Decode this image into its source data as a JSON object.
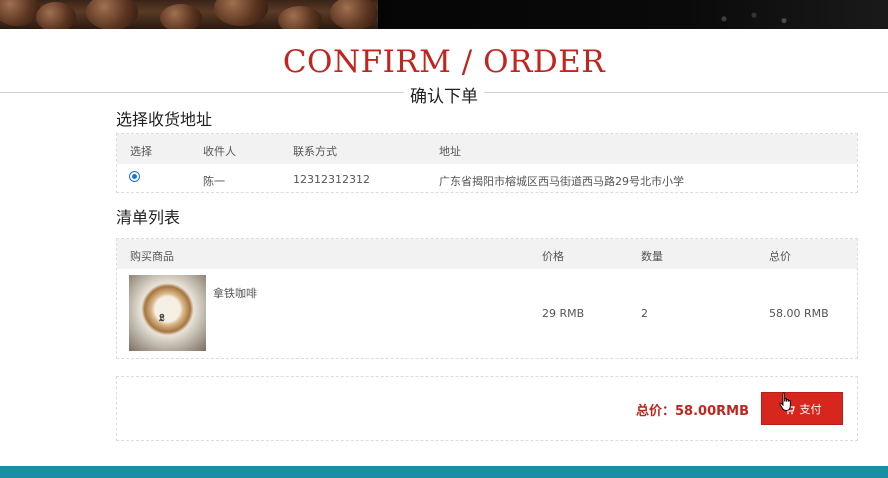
{
  "header": {
    "title_en": "CONFIRM / ORDER",
    "title_cn": "确认下单"
  },
  "address_section": {
    "title": "选择收货地址",
    "columns": [
      "选择",
      "收件人",
      "联系方式",
      "地址"
    ],
    "rows": [
      {
        "selected": true,
        "recipient": "陈一",
        "phone": "12312312312",
        "address": "广东省揭阳市榕城区西马街道西马路29号北市小学"
      }
    ]
  },
  "order_section": {
    "title": "清单列表",
    "columns": [
      "购买商品",
      "价格",
      "数量",
      "总价"
    ],
    "items": [
      {
        "name": "拿铁咖啡",
        "price": "29 RMB",
        "quantity": "2",
        "total": "58.00 RMB",
        "thumb_icon": "latte-image"
      }
    ]
  },
  "summary": {
    "total_label": "总价：58.00RMB",
    "pay_button_label": "支付",
    "pay_icon": "cart-icon"
  },
  "colors": {
    "accent_red": "#c0261d",
    "button_red": "#d7261d",
    "footer_teal": "#1b8ea6",
    "table_header_bg": "#f2f2f2"
  }
}
